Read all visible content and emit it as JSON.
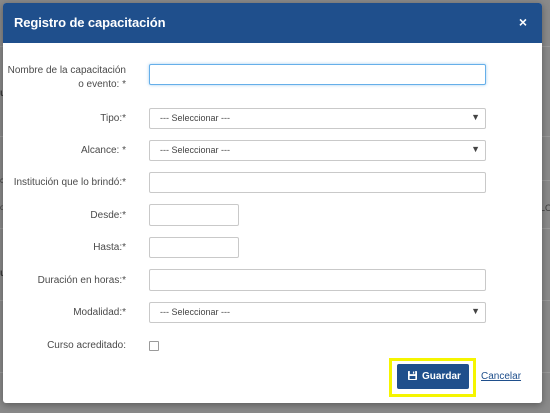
{
  "background": {
    "fragments": [
      "u",
      "c",
      "o",
      "LO",
      "u"
    ]
  },
  "modal": {
    "title": "Registro de capacitación",
    "close_icon": "close-icon",
    "close_glyph": "×"
  },
  "form": {
    "nombre": {
      "label": "Nombre de la capacitación o evento: *",
      "value": ""
    },
    "tipo": {
      "label": "Tipo:*",
      "selected": "--- Seleccionar ---"
    },
    "alcance": {
      "label": "Alcance: *",
      "selected": "--- Seleccionar ---"
    },
    "institucion": {
      "label": "Institución que lo brindó:*",
      "value": ""
    },
    "desde": {
      "label": "Desde:*",
      "value": ""
    },
    "hasta": {
      "label": "Hasta:*",
      "value": ""
    },
    "duracion": {
      "label": "Duración en horas:*",
      "value": ""
    },
    "modalidad": {
      "label": "Modalidad:*",
      "selected": "--- Seleccionar ---"
    },
    "curso_acreditado": {
      "label": "Curso acreditado:",
      "checked": false
    }
  },
  "actions": {
    "save_label": "Guardar",
    "save_icon": "floppy-disk-icon",
    "cancel_label": "Cancelar"
  },
  "colors": {
    "header": "#1f4f8c",
    "highlight": "#f5f500",
    "focus": "#66afe9"
  }
}
